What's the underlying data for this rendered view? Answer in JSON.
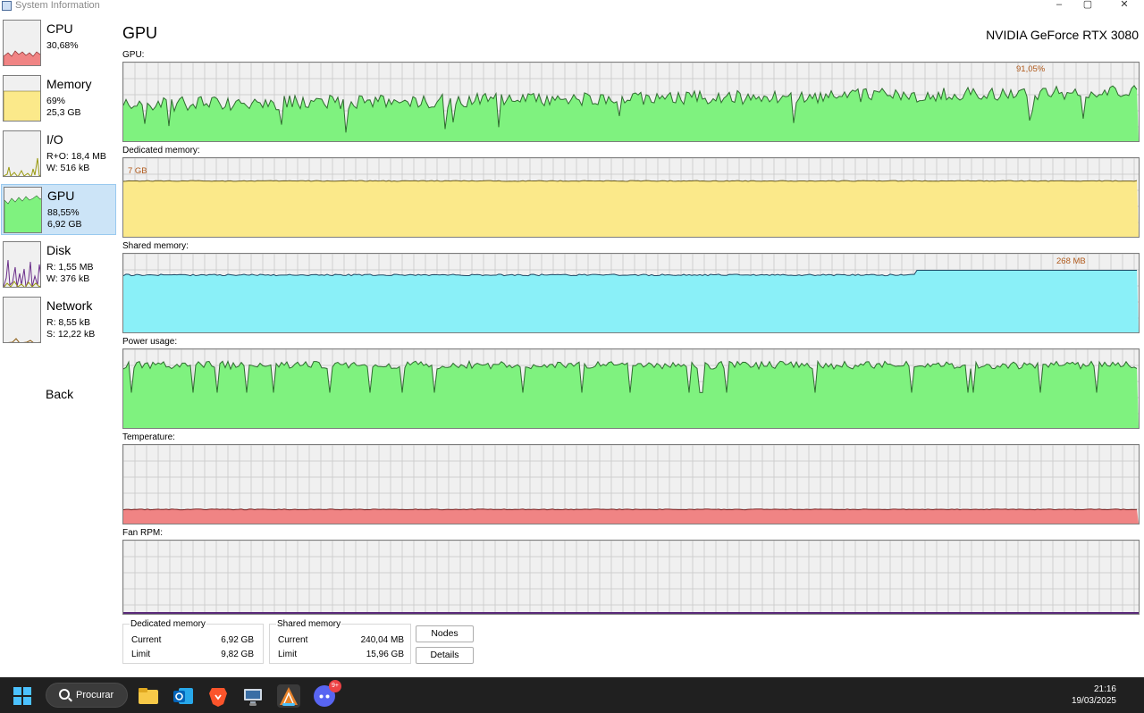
{
  "window": {
    "title": "System Information",
    "controls": {
      "minimize": "–",
      "maximize": "▢",
      "close": "✕"
    }
  },
  "sidebar": {
    "items": [
      {
        "name": "CPU",
        "line1": "30,68%",
        "line2": ""
      },
      {
        "name": "Memory",
        "line1": "69%",
        "line2": "25,3 GB"
      },
      {
        "name": "I/O",
        "line1": "R+O: 18,4 MB",
        "line2": "W: 516 kB"
      },
      {
        "name": "GPU",
        "line1": "88,55%",
        "line2": "6,92 GB"
      },
      {
        "name": "Disk",
        "line1": "R: 1,55 MB",
        "line2": "W: 376 kB"
      },
      {
        "name": "Network",
        "line1": "R: 8,55 kB",
        "line2": "S: 12,22 kB"
      }
    ],
    "back_label": "Back"
  },
  "main": {
    "title": "GPU",
    "gpu_name": "NVIDIA GeForce RTX 3080",
    "graphs": [
      {
        "label": "GPU:",
        "annotation": "91,05%",
        "color": "#7ff27f",
        "line": "#2f6b2f",
        "level": 0.62
      },
      {
        "label": "Dedicated memory:",
        "annotation": "7 GB",
        "color": "#fbe98a",
        "line": "#6b5c1d",
        "level": 0.71
      },
      {
        "label": "Shared memory:",
        "annotation": "268 MB",
        "color": "#8af0f8",
        "line": "#1e4a66",
        "level": 0.73
      },
      {
        "label": "Power usage:",
        "annotation": "",
        "color": "#7ff27f",
        "line": "#2f6b2f",
        "level": 0.8
      },
      {
        "label": "Temperature:",
        "annotation": "",
        "color": "#f08484",
        "line": "#7a1e1e",
        "level": 0.18
      },
      {
        "label": "Fan RPM:",
        "annotation": "",
        "color": "#f0f0f0",
        "line": "#5a2a7a",
        "level": 0.0
      }
    ]
  },
  "dedicated_box": {
    "title": "Dedicated memory",
    "current_label": "Current",
    "current_value": "6,92 GB",
    "limit_label": "Limit",
    "limit_value": "9,82 GB"
  },
  "shared_box": {
    "title": "Shared memory",
    "current_label": "Current",
    "current_value": "240,04 MB",
    "limit_label": "Limit",
    "limit_value": "15,96 GB"
  },
  "buttons": {
    "nodes": "Nodes",
    "details": "Details"
  },
  "taskbar": {
    "search_label": "Procurar",
    "time": "21:16",
    "date": "19/03/2025",
    "discord_badge": "9+"
  }
}
